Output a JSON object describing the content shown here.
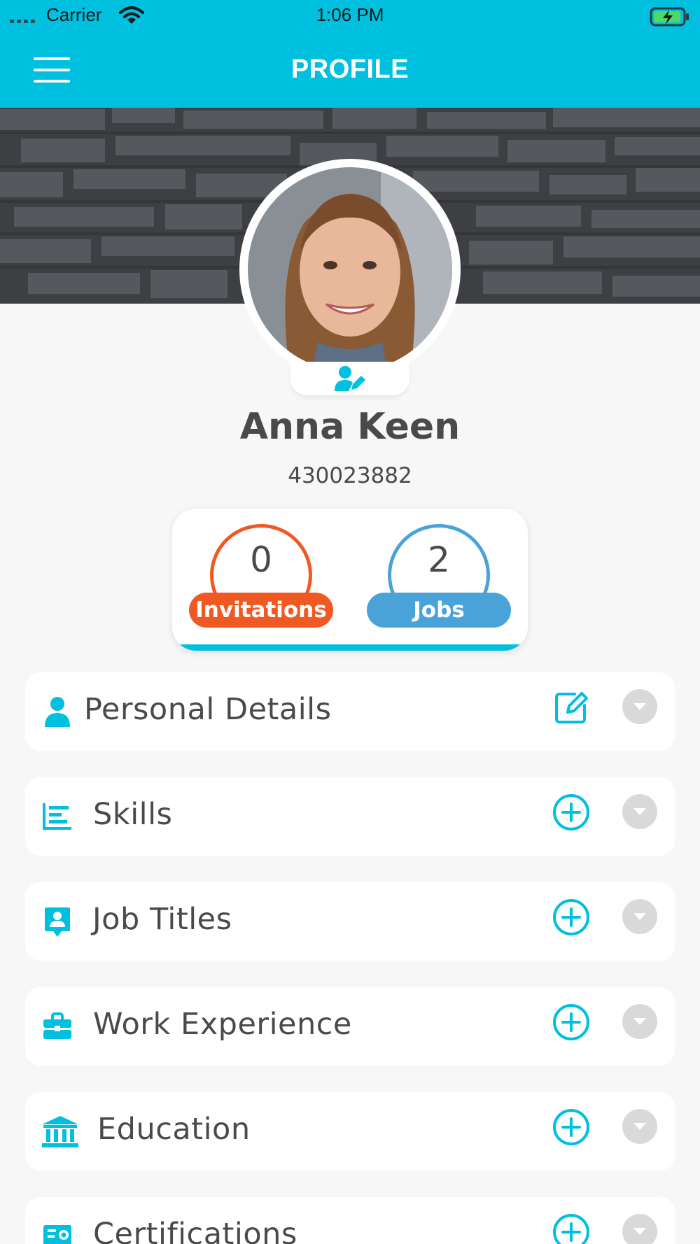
{
  "status_bar": {
    "carrier": "Carrier",
    "time": "1:06 PM"
  },
  "header": {
    "title": "PROFILE"
  },
  "profile": {
    "name": "Anna Keen",
    "id": "430023882"
  },
  "stats": {
    "invitations": {
      "count": "0",
      "label": "Invitations",
      "color": "#f05a22"
    },
    "jobs": {
      "count": "2",
      "label": "Jobs",
      "color": "#4aa3d8"
    }
  },
  "sections": [
    {
      "label": "Personal Details",
      "icon": "person-icon",
      "action": "edit-icon"
    },
    {
      "label": "Skills",
      "icon": "skills-icon",
      "action": "add-icon"
    },
    {
      "label": "Job Titles",
      "icon": "job-title-icon",
      "action": "add-icon"
    },
    {
      "label": "Work Experience",
      "icon": "briefcase-icon",
      "action": "add-icon"
    },
    {
      "label": "Education",
      "icon": "institution-icon",
      "action": "add-icon"
    },
    {
      "label": "Certifications",
      "icon": "certificate-icon",
      "action": "add-icon"
    }
  ],
  "colors": {
    "accent": "#00c0df",
    "text": "#4a4a4a",
    "expand_bg": "#d9d9d9"
  }
}
